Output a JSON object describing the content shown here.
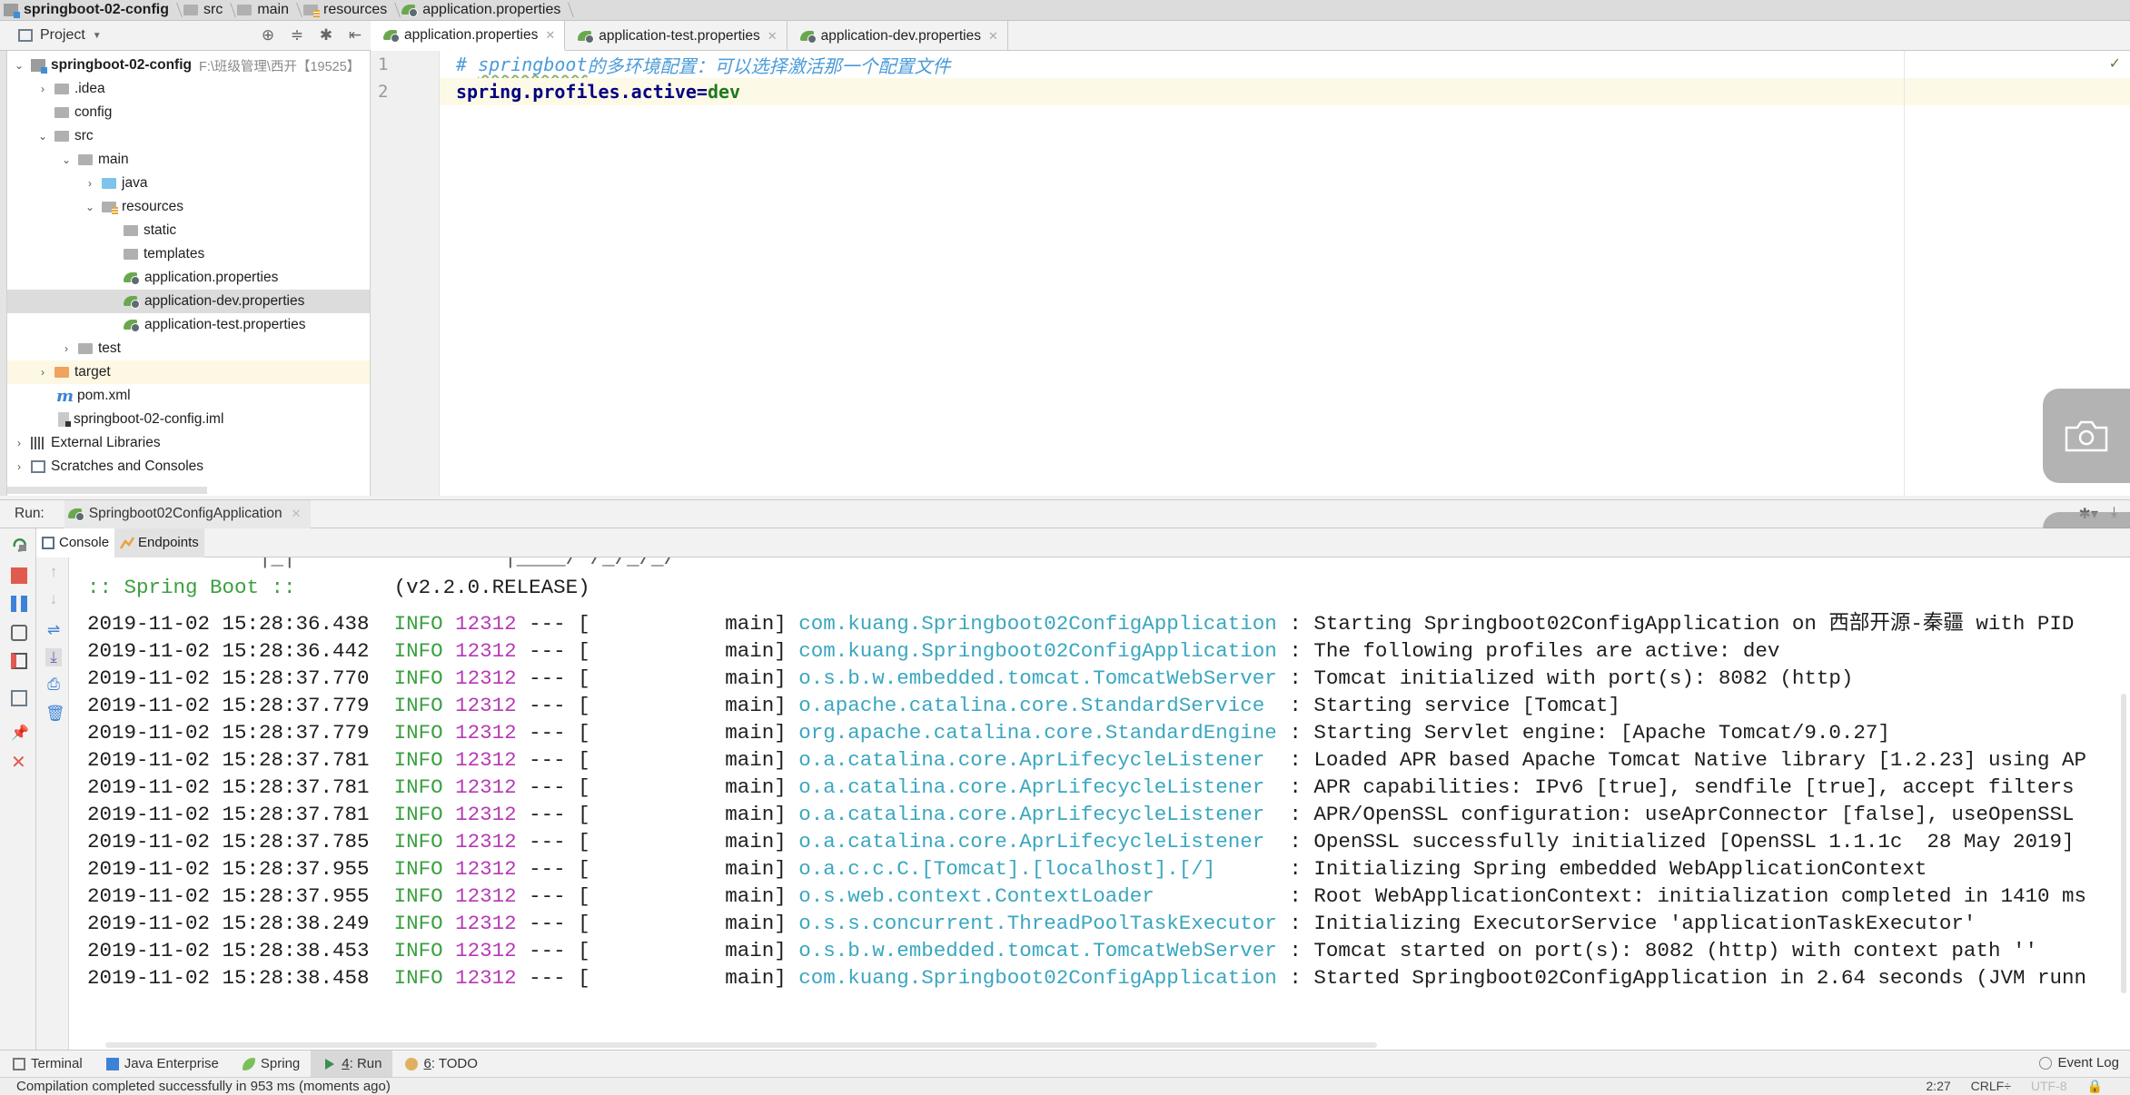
{
  "breadcrumb": [
    {
      "label": "springboot-02-config",
      "icon": "project-icon"
    },
    {
      "label": "src",
      "icon": "folder-icon"
    },
    {
      "label": "main",
      "icon": "folder-icon"
    },
    {
      "label": "resources",
      "icon": "resources-folder-icon"
    },
    {
      "label": "application.properties",
      "icon": "spring-properties-icon"
    }
  ],
  "project_panel": {
    "title": "Project",
    "tree": [
      {
        "label": "springboot-02-config",
        "path": "F:\\班级管理\\西开【19525】",
        "depth": 0,
        "expanded": true,
        "icon": "project-icon",
        "bold": true
      },
      {
        "label": ".idea",
        "depth": 1,
        "expanded": false,
        "icon": "folder-icon"
      },
      {
        "label": "config",
        "depth": 1,
        "icon": "folder-icon"
      },
      {
        "label": "src",
        "depth": 1,
        "expanded": true,
        "icon": "folder-icon"
      },
      {
        "label": "main",
        "depth": 2,
        "expanded": true,
        "icon": "folder-icon"
      },
      {
        "label": "java",
        "depth": 3,
        "expanded": false,
        "icon": "source-folder-icon"
      },
      {
        "label": "resources",
        "depth": 3,
        "expanded": true,
        "icon": "resources-folder-icon"
      },
      {
        "label": "static",
        "depth": 4,
        "icon": "folder-icon"
      },
      {
        "label": "templates",
        "depth": 4,
        "icon": "folder-icon"
      },
      {
        "label": "application.properties",
        "depth": 4,
        "icon": "spring-properties-icon"
      },
      {
        "label": "application-dev.properties",
        "depth": 4,
        "icon": "spring-properties-icon",
        "selected": true
      },
      {
        "label": "application-test.properties",
        "depth": 4,
        "icon": "spring-properties-icon"
      },
      {
        "label": "test",
        "depth": 2,
        "expanded": false,
        "icon": "folder-icon"
      },
      {
        "label": "target",
        "depth": 1,
        "expanded": false,
        "icon": "excluded-folder-icon",
        "highlight": true
      },
      {
        "label": "pom.xml",
        "depth": 1,
        "icon": "maven-icon"
      },
      {
        "label": "springboot-02-config.iml",
        "depth": 1,
        "icon": "iml-file-icon"
      },
      {
        "label": "External Libraries",
        "depth": 0,
        "expanded": false,
        "icon": "libraries-icon"
      },
      {
        "label": "Scratches and Consoles",
        "depth": 0,
        "expanded": false,
        "icon": "scratches-icon"
      }
    ]
  },
  "editor": {
    "tabs": [
      {
        "label": "application.properties",
        "active": true
      },
      {
        "label": "application-test.properties",
        "active": false
      },
      {
        "label": "application-dev.properties",
        "active": false
      }
    ],
    "lines": [
      {
        "number": "1",
        "comment_hash": "# ",
        "comment_word": "springboot",
        "comment_rest": "的多环境配置：可以选择激活那一个配置文件"
      },
      {
        "number": "2",
        "key": "spring.profiles.active",
        "eq": "=",
        "value": "dev"
      }
    ]
  },
  "run_panel": {
    "label": "Run:",
    "config_tab": "Springboot02ConfigApplication",
    "console_tabs": [
      "Console",
      "Endpoints"
    ],
    "banner_label": ":: Spring Boot ::",
    "banner_version": "(v2.2.0.RELEASE)",
    "log": [
      {
        "ts": "2019-11-02 15:28:36.438",
        "level": "INFO",
        "pid": "12312",
        "sep": "--- [",
        "thread": "main]",
        "logger": "com.kuang.Springboot02ConfigApplication",
        "message": ": Starting Springboot02ConfigApplication on 西部开源-秦疆 with PID"
      },
      {
        "ts": "2019-11-02 15:28:36.442",
        "level": "INFO",
        "pid": "12312",
        "sep": "--- [",
        "thread": "main]",
        "logger": "com.kuang.Springboot02ConfigApplication",
        "message": ": The following profiles are active: dev"
      },
      {
        "ts": "2019-11-02 15:28:37.770",
        "level": "INFO",
        "pid": "12312",
        "sep": "--- [",
        "thread": "main]",
        "logger": "o.s.b.w.embedded.tomcat.TomcatWebServer",
        "message": ": Tomcat initialized with port(s): 8082 (http)"
      },
      {
        "ts": "2019-11-02 15:28:37.779",
        "level": "INFO",
        "pid": "12312",
        "sep": "--- [",
        "thread": "main]",
        "logger": "o.apache.catalina.core.StandardService",
        "message": ": Starting service [Tomcat]"
      },
      {
        "ts": "2019-11-02 15:28:37.779",
        "level": "INFO",
        "pid": "12312",
        "sep": "--- [",
        "thread": "main]",
        "logger": "org.apache.catalina.core.StandardEngine",
        "message": ": Starting Servlet engine: [Apache Tomcat/9.0.27]"
      },
      {
        "ts": "2019-11-02 15:28:37.781",
        "level": "INFO",
        "pid": "12312",
        "sep": "--- [",
        "thread": "main]",
        "logger": "o.a.catalina.core.AprLifecycleListener",
        "message": ": Loaded APR based Apache Tomcat Native library [1.2.23] using AP"
      },
      {
        "ts": "2019-11-02 15:28:37.781",
        "level": "INFO",
        "pid": "12312",
        "sep": "--- [",
        "thread": "main]",
        "logger": "o.a.catalina.core.AprLifecycleListener",
        "message": ": APR capabilities: IPv6 [true], sendfile [true], accept filters"
      },
      {
        "ts": "2019-11-02 15:28:37.781",
        "level": "INFO",
        "pid": "12312",
        "sep": "--- [",
        "thread": "main]",
        "logger": "o.a.catalina.core.AprLifecycleListener",
        "message": ": APR/OpenSSL configuration: useAprConnector [false], useOpenSSL"
      },
      {
        "ts": "2019-11-02 15:28:37.785",
        "level": "INFO",
        "pid": "12312",
        "sep": "--- [",
        "thread": "main]",
        "logger": "o.a.catalina.core.AprLifecycleListener",
        "message": ": OpenSSL successfully initialized [OpenSSL 1.1.1c  28 May 2019]"
      },
      {
        "ts": "2019-11-02 15:28:37.955",
        "level": "INFO",
        "pid": "12312",
        "sep": "--- [",
        "thread": "main]",
        "logger": "o.a.c.c.C.[Tomcat].[localhost].[/]",
        "message": ": Initializing Spring embedded WebApplicationContext"
      },
      {
        "ts": "2019-11-02 15:28:37.955",
        "level": "INFO",
        "pid": "12312",
        "sep": "--- [",
        "thread": "main]",
        "logger": "o.s.web.context.ContextLoader",
        "message": ": Root WebApplicationContext: initialization completed in 1410 ms"
      },
      {
        "ts": "2019-11-02 15:28:38.249",
        "level": "INFO",
        "pid": "12312",
        "sep": "--- [",
        "thread": "main]",
        "logger": "o.s.s.concurrent.ThreadPoolTaskExecutor",
        "message": ": Initializing ExecutorService 'applicationTaskExecutor'"
      },
      {
        "ts": "2019-11-02 15:28:38.453",
        "level": "INFO",
        "pid": "12312",
        "sep": "--- [",
        "thread": "main]",
        "logger": "o.s.b.w.embedded.tomcat.TomcatWebServer",
        "message": ": Tomcat started on port(s): 8082 (http) with context path ''"
      },
      {
        "ts": "2019-11-02 15:28:38.458",
        "level": "INFO",
        "pid": "12312",
        "sep": "--- [",
        "thread": "main]",
        "logger": "com.kuang.Springboot02ConfigApplication",
        "message": ": Started Springboot02ConfigApplication in 2.64 seconds (JVM runn"
      }
    ]
  },
  "bottom_tools": [
    {
      "label": "Terminal",
      "icon": "terminal-icon"
    },
    {
      "label": "Java Enterprise",
      "icon": "java-enterprise-icon"
    },
    {
      "label": "Spring",
      "icon": "spring-leaf-icon"
    },
    {
      "label_num": "4",
      "label": ": Run",
      "icon": "run-icon",
      "active": true
    },
    {
      "label_num": "6",
      "label": ": TODO",
      "icon": "todo-icon"
    }
  ],
  "event_log": "Event Log",
  "status_bar": {
    "message": "Compilation completed successfully in 953 ms (moments ago)",
    "position": "2:27",
    "line_separator": "CRLF÷",
    "encoding": "UTF-8"
  },
  "colors": {
    "log_level": "#3aa040",
    "pid": "#b638b5",
    "logger": "#3aa6bf",
    "comment": "#4a9bd8",
    "property_key": "#000080",
    "property_value": "#1e7a1e"
  }
}
